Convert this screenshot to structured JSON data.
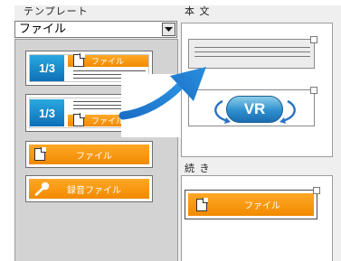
{
  "template_panel": {
    "label": "テンプレート",
    "select_value": "ファイル",
    "items": [
      {
        "page": "1/3",
        "title": "ファイル"
      },
      {
        "page": "1/3",
        "title": "ファイル"
      },
      {
        "title": "ファイル"
      },
      {
        "title": "録音ファイル"
      }
    ]
  },
  "main_panel": {
    "label": "本 文",
    "vr_label": "VR"
  },
  "continue_panel": {
    "label": "続 き",
    "item_title": "ファイル"
  },
  "colors": {
    "accent_orange": "#f39200",
    "badge_blue": "#1f8ccb",
    "arrow_blue": "#1e72c8"
  }
}
